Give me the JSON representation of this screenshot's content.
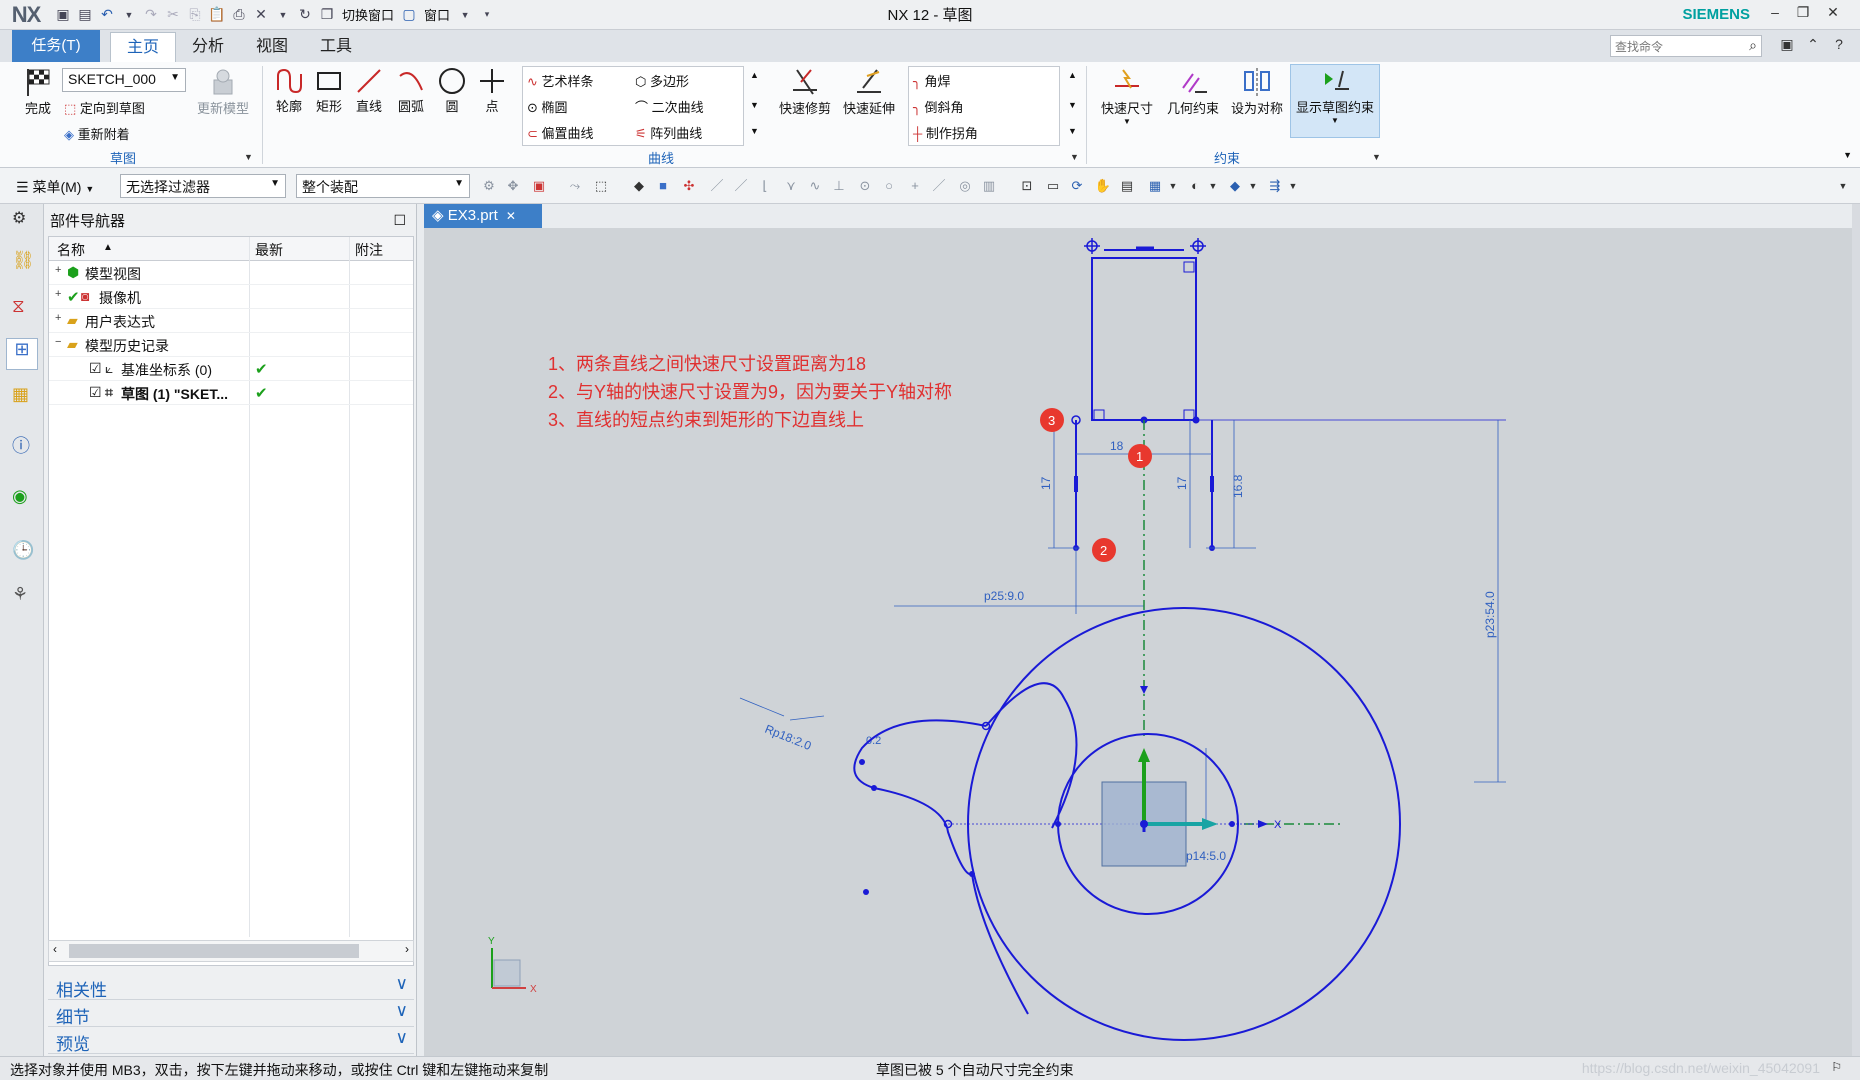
{
  "app": {
    "logo": "NX",
    "title": "NX 12 - 草图",
    "brand": "SIEMENS",
    "quick_access": {
      "switch_window": "切换窗口",
      "window": "窗口"
    }
  },
  "menu": {
    "task_tab": "任务(T)",
    "tabs": [
      "主页",
      "分析",
      "视图",
      "工具"
    ],
    "search_placeholder": "查找命令"
  },
  "ribbon": {
    "sketch_group": {
      "finish": "完成",
      "sketch_name": "SKETCH_000",
      "orient_to_sketch": "定向到草图",
      "reattach": "重新附着",
      "update_model": "更新模型",
      "label": "草图"
    },
    "curve_group": {
      "tools": [
        "轮廓",
        "矩形",
        "直线",
        "圆弧",
        "圆",
        "点"
      ],
      "gallery": [
        "艺术样条",
        "多边形",
        "椭圆",
        "二次曲线",
        "偏置曲线",
        "阵列曲线"
      ],
      "trim": "快速修剪",
      "extend": "快速延伸",
      "corner_list": [
        "角焊",
        "倒斜角",
        "制作拐角"
      ],
      "label": "曲线"
    },
    "constraint_group": {
      "rapid_dimension": "快速尺寸",
      "geometric_constraints": "几何约束",
      "make_symmetric": "设为对称",
      "show_constraints": "显示草图约束",
      "label": "约束"
    }
  },
  "toolbar2": {
    "menu": "菜单(M)",
    "filter": "无选择过滤器",
    "assembly_scope": "整个装配"
  },
  "navigator": {
    "title": "部件导航器",
    "columns": [
      "名称",
      "最新",
      "附注"
    ],
    "rows": [
      {
        "expander": "+",
        "label": "模型视图",
        "latest": ""
      },
      {
        "expander": "+",
        "label": "摄像机",
        "latest": ""
      },
      {
        "expander": "+",
        "label": "用户表达式",
        "latest": ""
      },
      {
        "expander": "−",
        "label": "模型历史记录",
        "latest": ""
      },
      {
        "expander": "",
        "label": "基准坐标系 (0)",
        "latest": "✔"
      },
      {
        "expander": "",
        "label": "草图 (1) \"SKET...",
        "latest": "✔"
      }
    ],
    "sections": [
      "相关性",
      "细节",
      "预览"
    ]
  },
  "graphics": {
    "tab_label": "EX3.prt",
    "annotations": [
      "1、两条直线之间快速尺寸设置距离为18",
      "2、与Y轴的快速尺寸设置为9，因为要关于Y轴对称",
      "3、直线的短点约束到矩形的下边直线上"
    ],
    "markers": [
      "1",
      "2",
      "3"
    ],
    "dimensions": {
      "d_18": "18",
      "d_17a": "17",
      "d_17b": "17",
      "d_16_8": "16.8",
      "p25": "p25:9.0",
      "p23": "p23:54.0",
      "r_p18": "Rp18:2.0",
      "p14": "p14:5.0",
      "r_small": "0.2"
    },
    "axis_labels": {
      "x": "X",
      "y": "Y"
    }
  },
  "status": {
    "left": "选择对象并使用 MB3，双击，按下左键并拖动来移动，或按住 Ctrl 键和左键拖动来复制",
    "center": "草图已被 5 个自动尺寸完全约束",
    "watermark": "https://blog.csdn.net/weixin_45042091"
  },
  "colors": {
    "sketch_blue": "#1a1ad6",
    "annotation_red": "#e03030",
    "marker_red": "#e8382e",
    "accent_blue": "#3d7fc8"
  }
}
